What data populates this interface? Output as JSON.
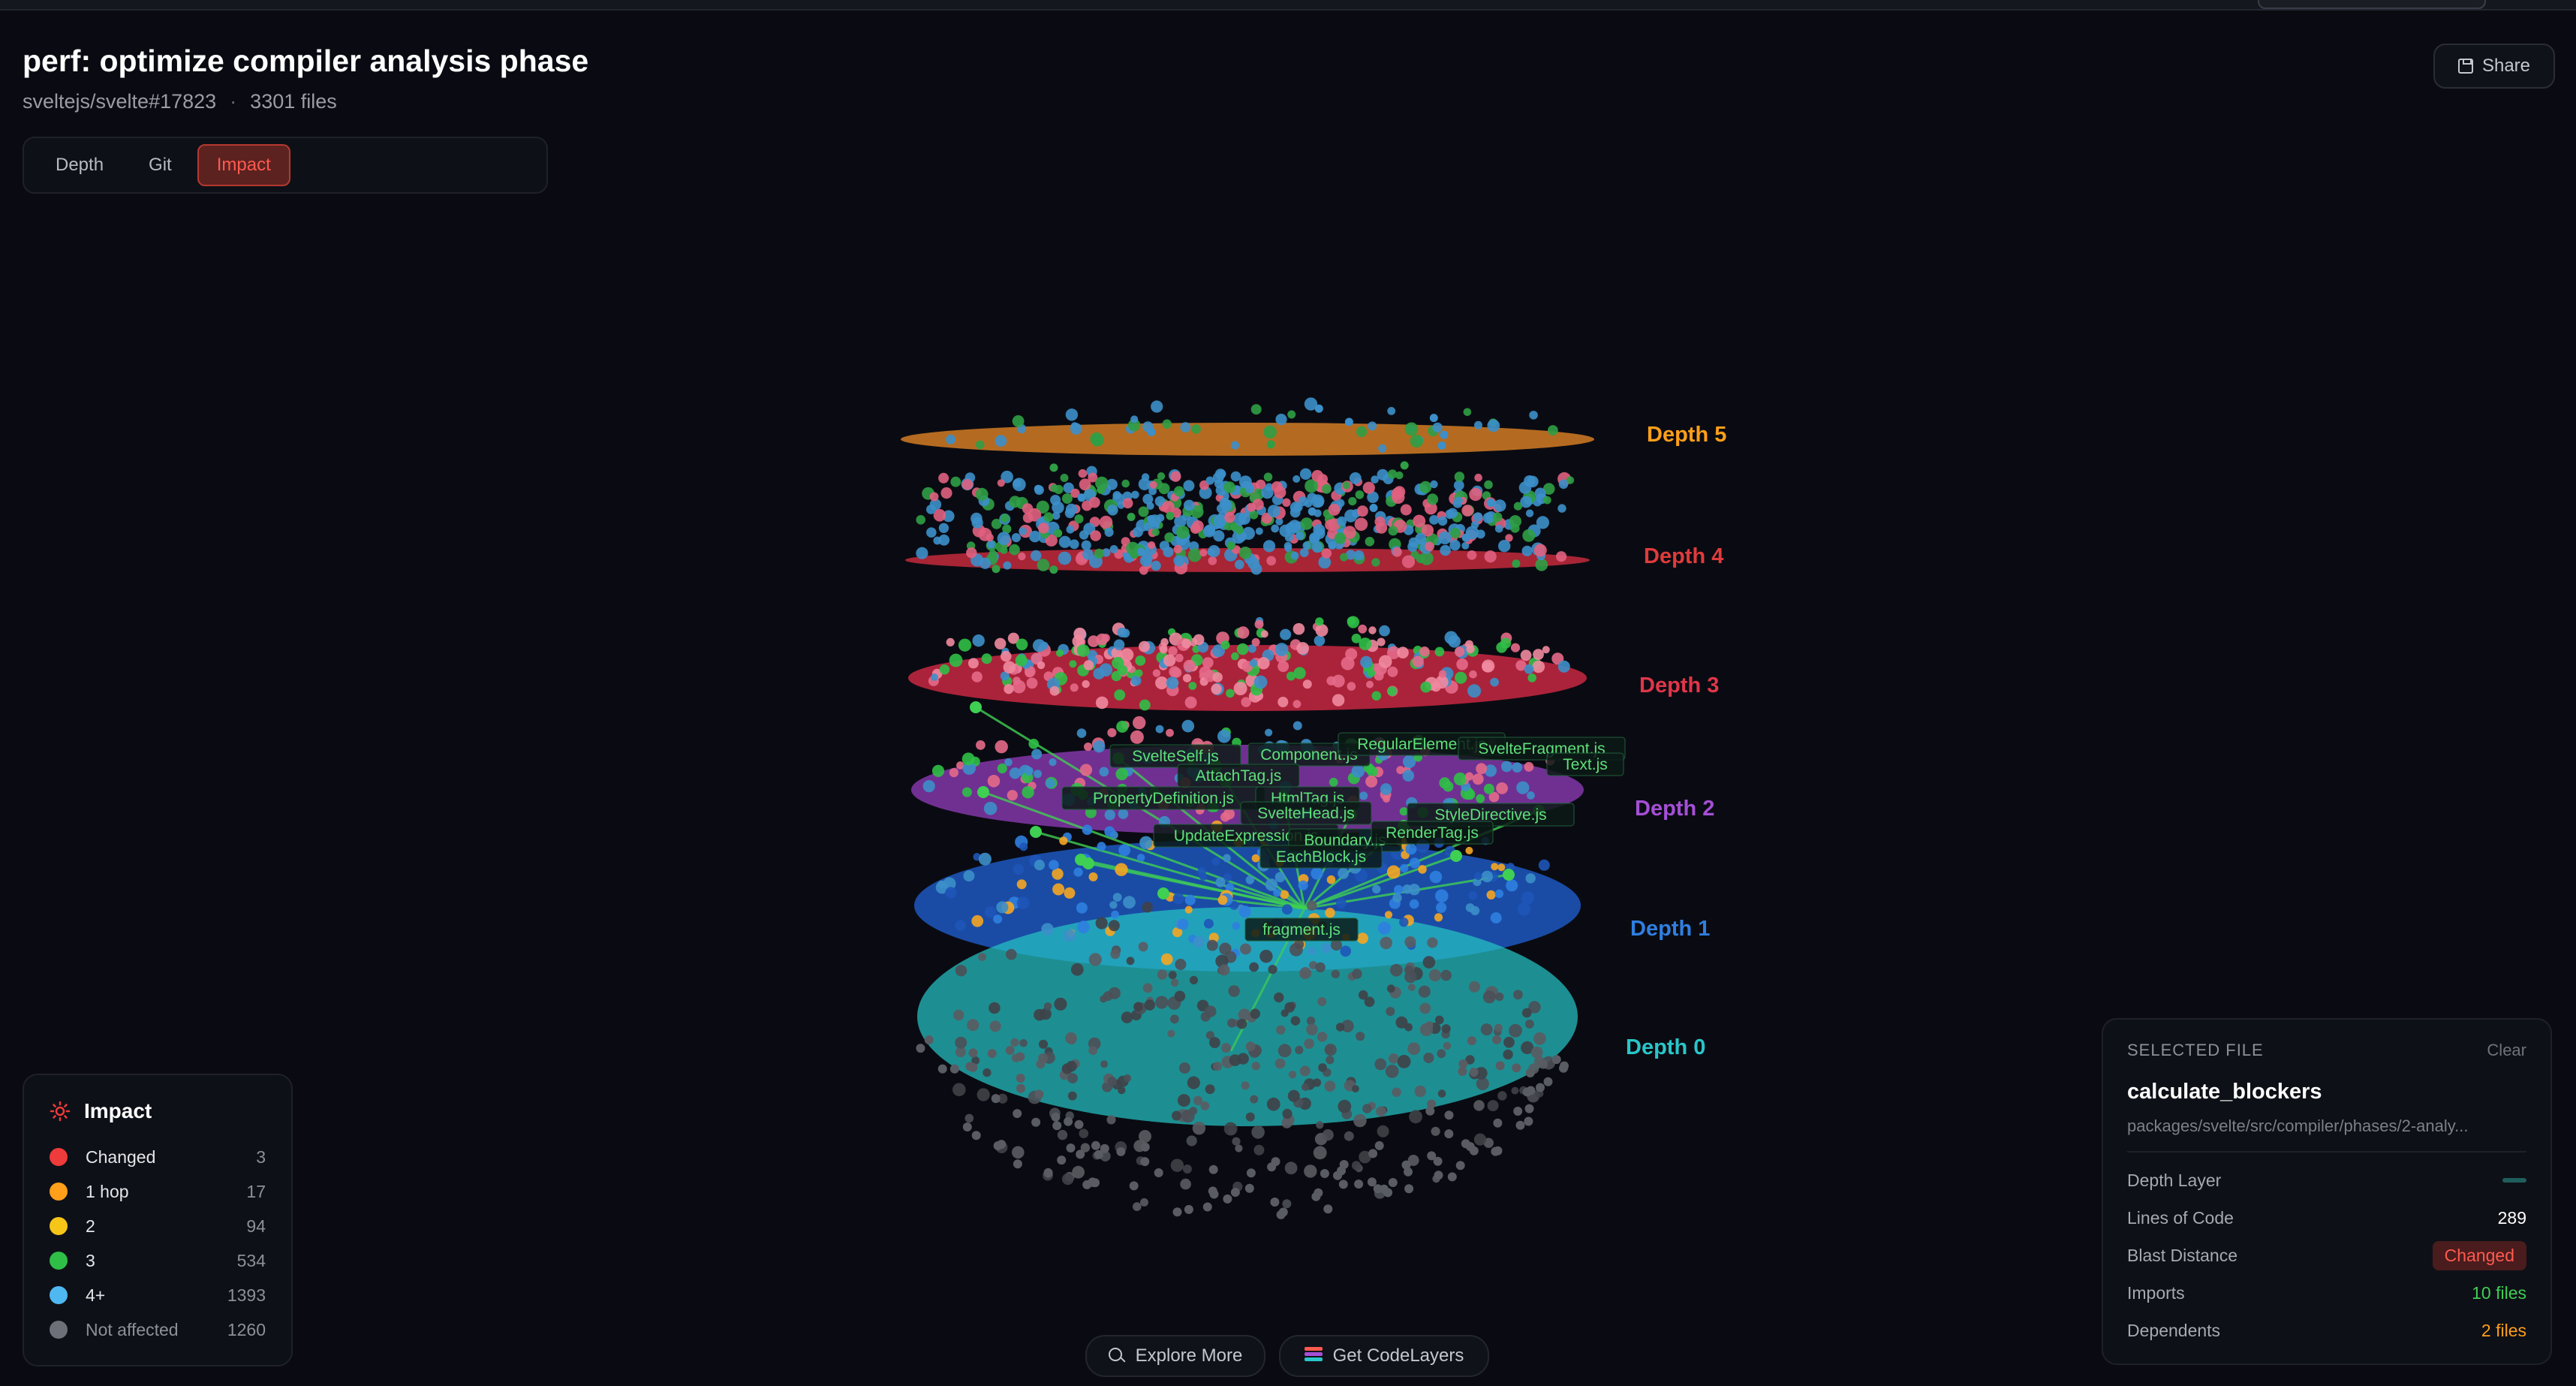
{
  "header": {
    "title": "perf: optimize compiler analysis phase",
    "repo": "sveltejs/svelte#17823",
    "separator": "·",
    "files": "3301 files",
    "share_label": "Share"
  },
  "modes": [
    {
      "label": "Depth",
      "active": false
    },
    {
      "label": "Git",
      "active": false
    },
    {
      "label": "Impact",
      "active": true
    }
  ],
  "scene": {
    "depth_labels": [
      {
        "label": "Depth 5",
        "color": "#ff9f1a"
      },
      {
        "label": "Depth 4",
        "color": "#e03b3b"
      },
      {
        "label": "Depth 3",
        "color": "#e0364a"
      },
      {
        "label": "Depth 2",
        "color": "#a54fd6"
      },
      {
        "label": "Depth 1",
        "color": "#2f7fe0"
      },
      {
        "label": "Depth 0",
        "color": "#29c6c9"
      }
    ],
    "file_labels": [
      "SvelteSelf.js",
      "Component.js",
      "RegularElement.js",
      "SvelteFragment.js",
      "Text.js",
      "AttachTag.js",
      "PropertyDefinition.js",
      "HtmlTag.js",
      "SvelteHead.js",
      "StyleDirective.js",
      "UpdateExpression.js",
      "Boundary.js",
      "RenderTag.js",
      "EachBlock.js",
      "fragment.js"
    ]
  },
  "legend": {
    "title": "Impact",
    "items": [
      {
        "label": "Changed",
        "count": "3",
        "color": "#ef3b3b"
      },
      {
        "label": "1 hop",
        "count": "17",
        "color": "#ff9f1a"
      },
      {
        "label": "2",
        "count": "94",
        "color": "#f5c518"
      },
      {
        "label": "3",
        "count": "534",
        "color": "#2fbf47"
      },
      {
        "label": "4+",
        "count": "1393",
        "color": "#4fb8f0"
      },
      {
        "label": "Not affected",
        "count": "1260",
        "color": "#6e7079"
      }
    ]
  },
  "selected_file": {
    "heading": "SELECTED FILE",
    "clear_label": "Clear",
    "name": "calculate_blockers",
    "path": "packages/svelte/src/compiler/phases/2-analy...",
    "depth_layer_label": "Depth Layer",
    "lines_label": "Lines of Code",
    "lines_value": "289",
    "blast_label": "Blast Distance",
    "blast_value": "Changed",
    "imports_label": "Imports",
    "imports_value": "10 files",
    "dependents_label": "Dependents",
    "dependents_value": "2 files"
  },
  "bottom": {
    "explore_label": "Explore More",
    "get_label": "Get CodeLayers"
  }
}
